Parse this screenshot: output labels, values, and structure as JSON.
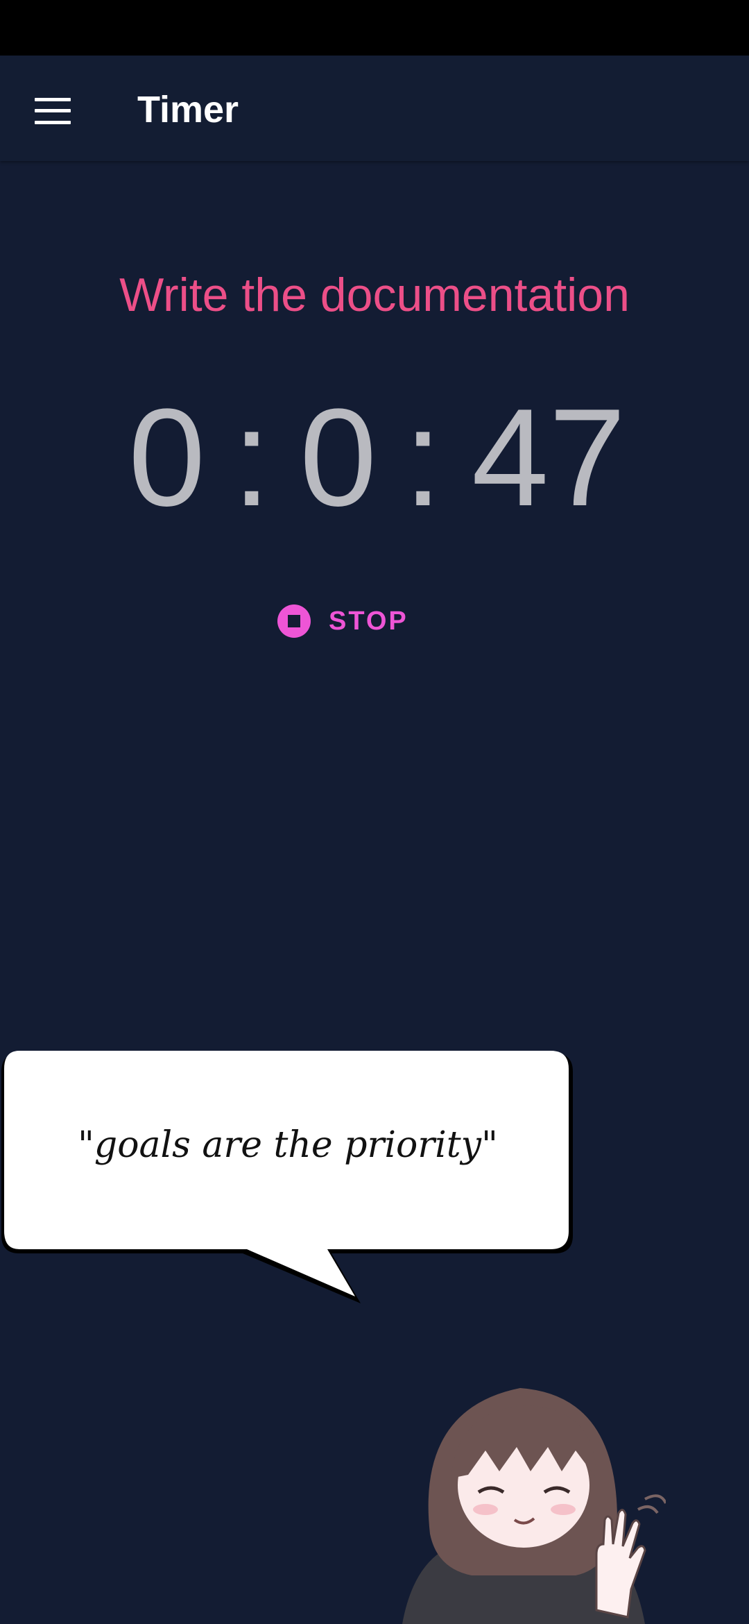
{
  "app_bar": {
    "title": "Timer",
    "menu_icon": "hamburger-menu-icon"
  },
  "task": {
    "title": "Write the documentation"
  },
  "timer": {
    "hours": "0",
    "minutes": "0",
    "seconds": "47",
    "separator": ":"
  },
  "controls": {
    "stop_label": "STOP",
    "stop_icon": "stop-circle-icon"
  },
  "quote": {
    "text": "\"goals are the priority\""
  },
  "colors": {
    "background": "#131c33",
    "accent_pink": "#ec4f88",
    "button_magenta": "#ee55d6",
    "timer_text": "#b9bac0"
  }
}
